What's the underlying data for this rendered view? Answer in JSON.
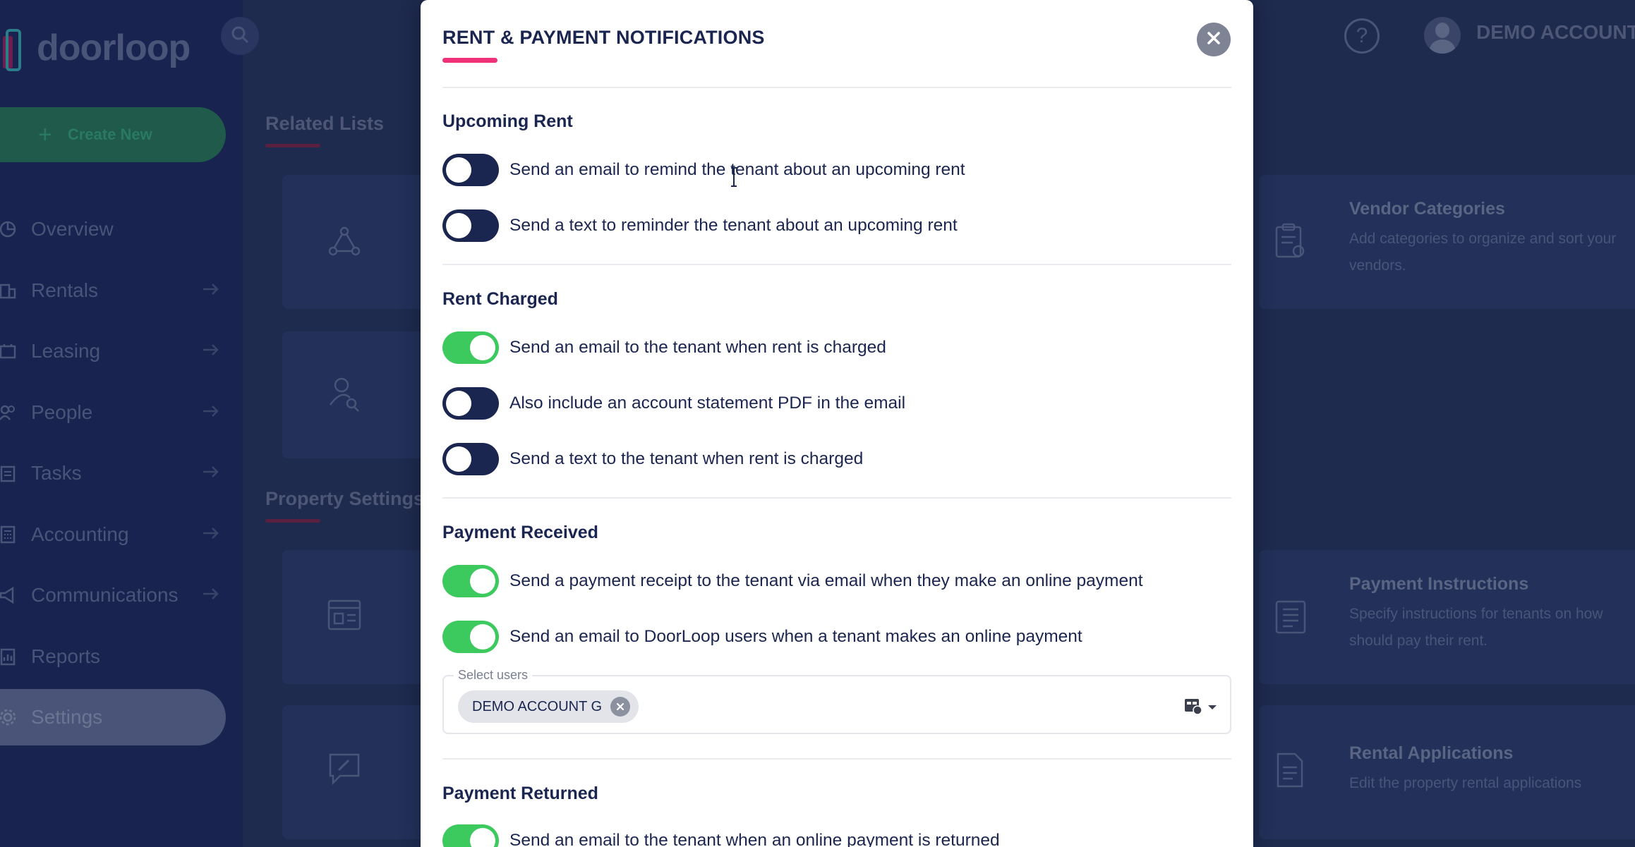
{
  "app": {
    "logo_text": "doorloop",
    "create_label": "Create New",
    "nav": [
      {
        "label": "Overview",
        "arrow": false
      },
      {
        "label": "Rentals",
        "arrow": true
      },
      {
        "label": "Leasing",
        "arrow": true
      },
      {
        "label": "People",
        "arrow": true
      },
      {
        "label": "Tasks",
        "arrow": true
      },
      {
        "label": "Accounting",
        "arrow": true
      },
      {
        "label": "Communications",
        "arrow": true
      },
      {
        "label": "Reports",
        "arrow": false
      },
      {
        "label": "Settings",
        "arrow": false,
        "active": true
      }
    ],
    "account_name": "DEMO ACCOUNT"
  },
  "background": {
    "related_lists_title": "Related Lists",
    "property_settings_title": "Property Settings",
    "cards": {
      "vendor_categories": {
        "title": "Vendor Categories",
        "desc_line1": "Add categories to organize and sort your",
        "desc_line2": "vendors."
      },
      "payment_instructions": {
        "title": "Payment Instructions",
        "desc_line1": "Specify instructions for tenants on how",
        "desc_line2": "should pay their rent."
      },
      "rental_applications": {
        "title": "Rental Applications",
        "desc_line1": "Edit the property rental applications"
      }
    }
  },
  "modal": {
    "title": "RENT & PAYMENT NOTIFICATIONS",
    "sections": {
      "upcoming": {
        "title": "Upcoming Rent",
        "items": [
          {
            "label": "Send an email to remind the tenant about an upcoming rent",
            "on": false
          },
          {
            "label": "Send a text to reminder the tenant about an upcoming rent",
            "on": false
          }
        ]
      },
      "charged": {
        "title": "Rent Charged",
        "items": [
          {
            "label": "Send an email to the tenant when rent is charged",
            "on": true
          },
          {
            "label": "Also include an account statement PDF in the email",
            "on": false
          },
          {
            "label": "Send a text to the tenant when rent is charged",
            "on": false
          }
        ]
      },
      "received": {
        "title": "Payment Received",
        "items": [
          {
            "label": "Send a payment receipt to the tenant via email when they make an online payment",
            "on": true
          },
          {
            "label": "Send an email to DoorLoop users when a tenant makes an online payment",
            "on": true
          }
        ],
        "select_label": "Select users",
        "selected_user": "DEMO ACCOUNT G"
      },
      "returned": {
        "title": "Payment Returned",
        "items": [
          {
            "label": "Send an email to the tenant when an online payment is returned",
            "on": true
          }
        ]
      }
    }
  },
  "colors": {
    "accent_pink": "#f0317a",
    "toggle_on": "#3cc95d",
    "toggle_off": "#1b2650",
    "navy": "#1b2650"
  }
}
